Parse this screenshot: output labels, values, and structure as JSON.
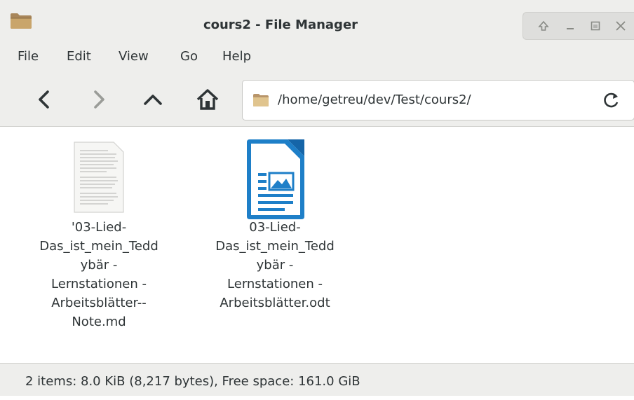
{
  "window": {
    "title": "cours2 - File Manager",
    "app_icon": "folder-icon",
    "controls": [
      "keep-above-icon",
      "minimize-icon",
      "maximize-icon",
      "close-icon"
    ]
  },
  "menubar": {
    "items": [
      "File",
      "Edit",
      "View",
      "Go",
      "Help"
    ]
  },
  "toolbar": {
    "back_icon": "chevron-left-icon",
    "forward_icon": "chevron-right-icon",
    "up_icon": "chevron-up-icon",
    "home_icon": "home-icon",
    "path_value": "/home/getreu/dev/Test/cours2/",
    "reload_icon": "reload-icon"
  },
  "files": [
    {
      "name": "'03-Lied-\nDas_ist_mein_Tedd\nybär -\nLernstationen -\nArbeitsblätter--\nNote.md",
      "icon": "text-document-icon"
    },
    {
      "name": "03-Lied-\nDas_ist_mein_Tedd\nybär -\nLernstationen -\nArbeitsblätter.odt",
      "icon": "writer-document-icon"
    }
  ],
  "statusbar": {
    "text": "2 items: 8.0 KiB (8,217 bytes), Free space: 161.0 GiB"
  },
  "colors": {
    "chrome": "#eeeeec",
    "folder": "#c9a56b",
    "writer_blue": "#1e7fc8",
    "text": "#2e3436"
  }
}
